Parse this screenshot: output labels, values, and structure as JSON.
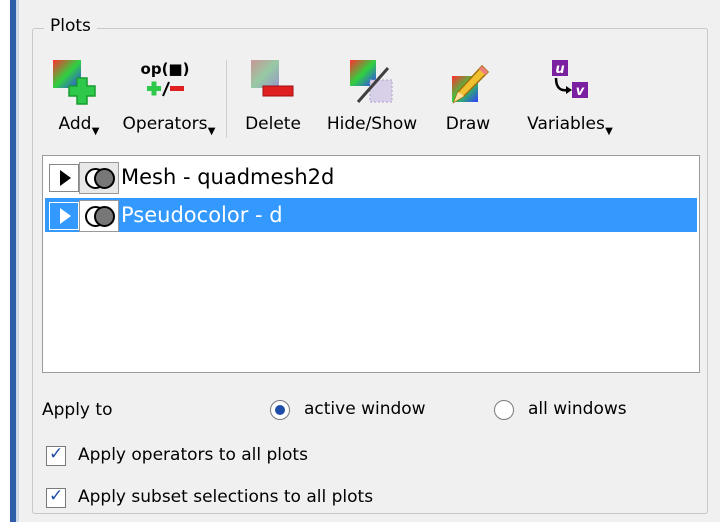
{
  "group": {
    "title": "Plots"
  },
  "toolbar": {
    "add": "Add",
    "operators": "Operators",
    "delete": "Delete",
    "hide_show": "Hide/Show",
    "draw": "Draw",
    "variables": "Variables",
    "op_glyph": "op(■)"
  },
  "plots": [
    {
      "name": "Mesh - quadmesh2d",
      "selected": false
    },
    {
      "name": "Pseudocolor - d",
      "selected": true
    }
  ],
  "apply_to": {
    "label": "Apply to",
    "active": "active window",
    "all": "all windows",
    "selected": "active window"
  },
  "options": {
    "operators_all": "Apply operators to all plots",
    "subset_all": "Apply subset selections to all plots",
    "operators_all_checked": true,
    "subset_all_checked": true
  },
  "icons": {
    "add": "add-plot-icon",
    "operators": "operators-icon",
    "delete": "delete-plot-icon",
    "hide_show": "hide-show-icon",
    "draw": "draw-icon",
    "variables": "variables-icon"
  }
}
